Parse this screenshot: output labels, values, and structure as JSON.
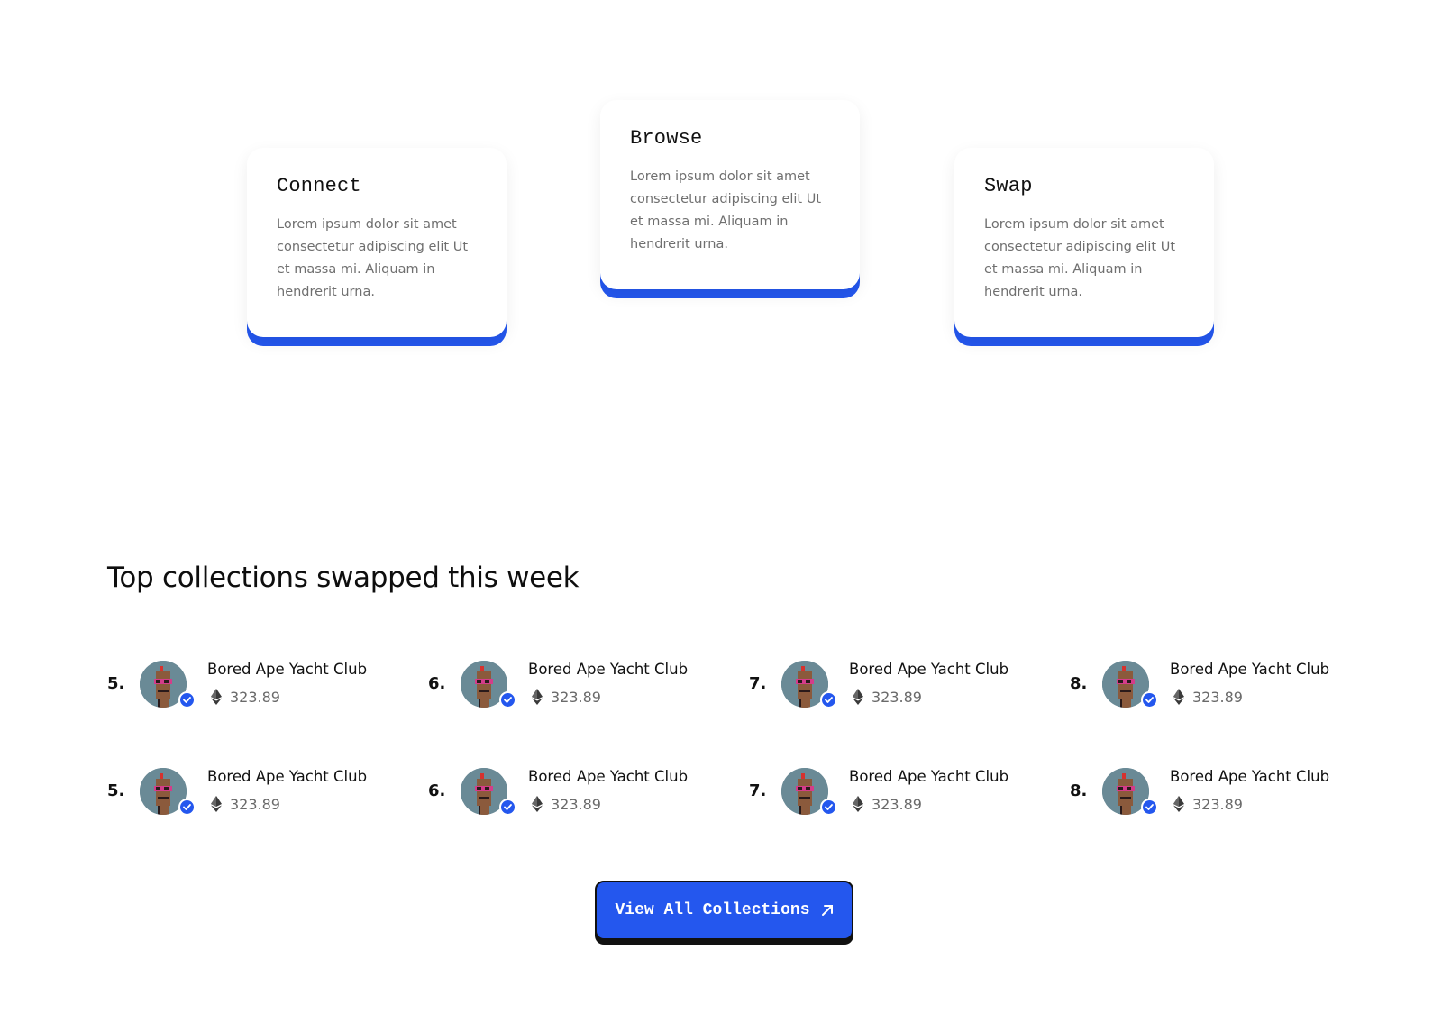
{
  "steps": [
    {
      "title": "Connect",
      "body": "Lorem ipsum dolor sit amet consectetur adipiscing elit Ut et massa mi. Aliquam in hendrerit urna."
    },
    {
      "title": "Browse",
      "body": "Lorem ipsum dolor sit amet consectetur adipiscing elit Ut et massa mi. Aliquam in hendrerit urna."
    },
    {
      "title": "Swap",
      "body": "Lorem ipsum dolor sit amet consectetur adipiscing elit Ut et massa mi. Aliquam in hendrerit urna."
    }
  ],
  "collections": {
    "title": "Top collections swapped this week",
    "rows": [
      [
        {
          "rank": "5.",
          "name": "Bored Ape Yacht Club",
          "price": "323.89"
        },
        {
          "rank": "6.",
          "name": "Bored Ape Yacht Club",
          "price": "323.89"
        },
        {
          "rank": "7.",
          "name": "Bored Ape Yacht Club",
          "price": "323.89"
        },
        {
          "rank": "8.",
          "name": "Bored Ape Yacht Club",
          "price": "323.89"
        }
      ],
      [
        {
          "rank": "5.",
          "name": "Bored Ape Yacht Club",
          "price": "323.89"
        },
        {
          "rank": "6.",
          "name": "Bored Ape Yacht Club",
          "price": "323.89"
        },
        {
          "rank": "7.",
          "name": "Bored Ape Yacht Club",
          "price": "323.89"
        },
        {
          "rank": "8.",
          "name": "Bored Ape Yacht Club",
          "price": "323.89"
        }
      ]
    ],
    "icons": {
      "currency": "ethereum-icon",
      "badge": "verified-check-icon",
      "avatar": "pixel-punk-avatar"
    }
  },
  "cta": {
    "label": "View All Collections",
    "icon": "arrow-up-right-icon"
  },
  "colors": {
    "accent": "#2457ee",
    "avatar_bg": "#6a8a96",
    "text": "#111111",
    "muted": "#6f6f6f"
  }
}
